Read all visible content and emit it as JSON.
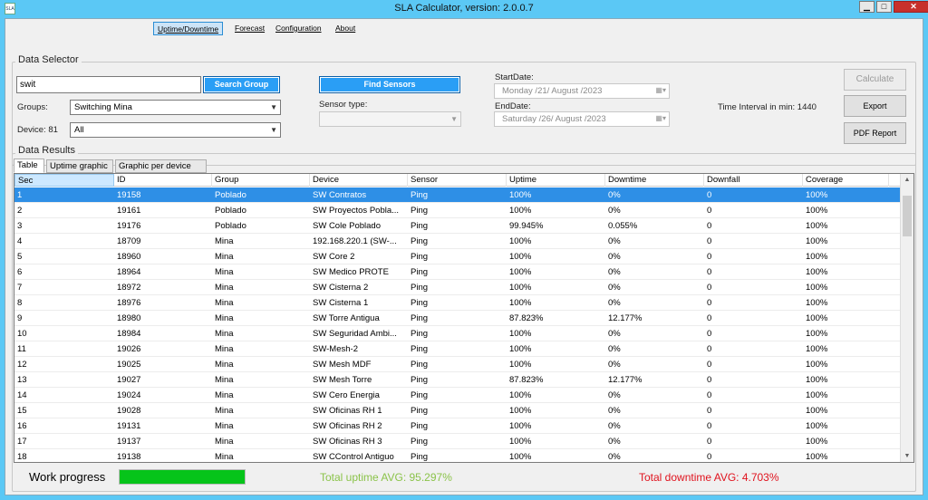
{
  "window": {
    "title": "SLA Calculator, version: 2.0.0.7",
    "icon_name": "app-icon",
    "minimize_glyph": "▁",
    "maximize_glyph": "□",
    "close_glyph": "✕"
  },
  "menu": {
    "items": [
      "Uptime/Downtime",
      "Forecast",
      "Configuration",
      "About"
    ]
  },
  "data_selector": {
    "title": "Data Selector",
    "search_value": "swit",
    "search_button": "Search Group",
    "groups_label": "Groups:",
    "groups_value": "Switching Mina",
    "device_label": "Device: 81",
    "device_value": "All",
    "find_sensors_button": "Find Sensors",
    "sensor_type_label": "Sensor type:",
    "sensor_type_value": "",
    "start_date_label": "StartDate:",
    "start_date_value": "Monday   /21/   August   /2023",
    "end_date_label": "EndDate:",
    "end_date_value": "Saturday  /26/   August   /2023",
    "time_interval": "Time Interval in min: 1440",
    "calculate_button": "Calculate",
    "export_button": "Export",
    "pdf_button": "PDF Report"
  },
  "results": {
    "title": "Data Results",
    "tabs": [
      "Table",
      "Uptime graphic",
      "Graphic per device"
    ],
    "columns": [
      "Sec",
      "ID",
      "Group",
      "Device",
      "Sensor",
      "Uptime",
      "Downtime",
      "Downfall",
      "Coverage"
    ],
    "rows": [
      [
        "1",
        "19158",
        "Poblado",
        "SW Contratos",
        "Ping",
        "100%",
        "0%",
        "0",
        "100%"
      ],
      [
        "2",
        "19161",
        "Poblado",
        "SW Proyectos Pobla...",
        "Ping",
        "100%",
        "0%",
        "0",
        "100%"
      ],
      [
        "3",
        "19176",
        "Poblado",
        "SW Cole Poblado",
        "Ping",
        "99.945%",
        "0.055%",
        "0",
        "100%"
      ],
      [
        "4",
        "18709",
        "Mina",
        "192.168.220.1 (SW-...",
        "Ping",
        "100%",
        "0%",
        "0",
        "100%"
      ],
      [
        "5",
        "18960",
        "Mina",
        "SW Core 2",
        "Ping",
        "100%",
        "0%",
        "0",
        "100%"
      ],
      [
        "6",
        "18964",
        "Mina",
        "SW Medico PROTE",
        "Ping",
        "100%",
        "0%",
        "0",
        "100%"
      ],
      [
        "7",
        "18972",
        "Mina",
        "SW Cisterna 2",
        "Ping",
        "100%",
        "0%",
        "0",
        "100%"
      ],
      [
        "8",
        "18976",
        "Mina",
        "SW Cisterna 1",
        "Ping",
        "100%",
        "0%",
        "0",
        "100%"
      ],
      [
        "9",
        "18980",
        "Mina",
        "SW Torre Antigua",
        "Ping",
        "87.823%",
        "12.177%",
        "0",
        "100%"
      ],
      [
        "10",
        "18984",
        "Mina",
        "SW Seguridad Ambi...",
        "Ping",
        "100%",
        "0%",
        "0",
        "100%"
      ],
      [
        "11",
        "19026",
        "Mina",
        "SW-Mesh-2",
        "Ping",
        "100%",
        "0%",
        "0",
        "100%"
      ],
      [
        "12",
        "19025",
        "Mina",
        "SW Mesh MDF",
        "Ping",
        "100%",
        "0%",
        "0",
        "100%"
      ],
      [
        "13",
        "19027",
        "Mina",
        "SW Mesh Torre",
        "Ping",
        "87.823%",
        "12.177%",
        "0",
        "100%"
      ],
      [
        "14",
        "19024",
        "Mina",
        "SW Cero Energia",
        "Ping",
        "100%",
        "0%",
        "0",
        "100%"
      ],
      [
        "15",
        "19028",
        "Mina",
        "SW Oficinas RH 1",
        "Ping",
        "100%",
        "0%",
        "0",
        "100%"
      ],
      [
        "16",
        "19131",
        "Mina",
        "SW Oficinas RH 2",
        "Ping",
        "100%",
        "0%",
        "0",
        "100%"
      ],
      [
        "17",
        "19137",
        "Mina",
        "SW Oficinas RH 3",
        "Ping",
        "100%",
        "0%",
        "0",
        "100%"
      ],
      [
        "18",
        "19138",
        "Mina",
        "SW CControl Antiguo",
        "Ping",
        "100%",
        "0%",
        "0",
        "100%"
      ]
    ],
    "selected_row": 0
  },
  "footer": {
    "work_progress_label": "Work progress",
    "progress_fraction": 1.0,
    "uptime_avg": "Total uptime AVG: 95.297%",
    "downtime_avg": "Total downtime AVG: 4.703%"
  },
  "colors": {
    "accent": "#2a9ef5",
    "selection": "#2e8fe6",
    "progress": "#06c41a",
    "uptime_text": "#8bc34a",
    "downtime_text": "#e0131e"
  }
}
